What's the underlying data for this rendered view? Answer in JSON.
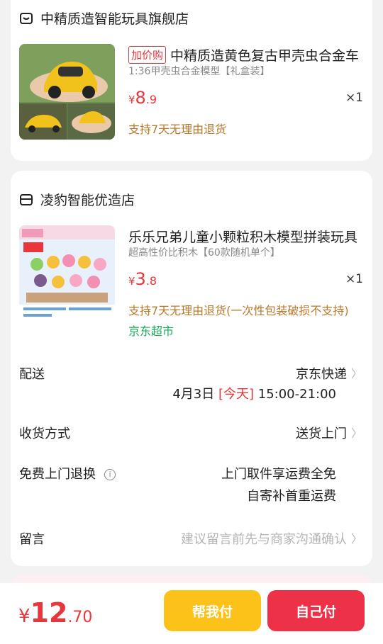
{
  "store1": {
    "name": "中精质造智能玩具旗舰店",
    "icon": "store-icon",
    "product": {
      "tag": "加价购",
      "title": "中精质造黄色复古甲壳虫合金车",
      "spec": "1:36甲壳虫合金模型【礼盒装】",
      "price_symbol": "¥",
      "price_int": "8",
      "price_dec": ".9",
      "qty": "×1",
      "return_policy": "支持7天无理由退货"
    }
  },
  "store2": {
    "name": "凌豹智能优造店",
    "icon": "store-icon",
    "product": {
      "title": "乐乐兄弟儿童小颗粒积木模型拼装玩具",
      "spec": "超高性价比积木【60款随机单个】",
      "price_symbol": "¥",
      "price_int": "3",
      "price_dec": ".8",
      "qty": "×1",
      "return_policy": "支持7天无理由退货(一次性包装破损不支持)",
      "badge": "京东超市"
    }
  },
  "delivery": {
    "label": "配送",
    "carrier": "京东快递",
    "date": "4月3日",
    "today": "[今天]",
    "time": "15:00-21:00"
  },
  "receive": {
    "label": "收货方式",
    "value": "送货上门"
  },
  "free_return": {
    "label": "免费上门退换",
    "info": "i",
    "line1": "上门取件享运费全免",
    "line2": "自寄补首重运费"
  },
  "message": {
    "label": "留言",
    "placeholder": "建议留言前先与商家沟通确认"
  },
  "chevron": "〉",
  "footer": {
    "total_symbol": "¥",
    "total_int": "12",
    "total_dec": ".70",
    "help_pay": "帮我付",
    "self_pay": "自己付"
  },
  "colors": {
    "accent": "#e8363d",
    "help": "#fdc21a",
    "self": "#ec3148",
    "return": "#b8782b",
    "jd_green": "#1aa95a"
  }
}
